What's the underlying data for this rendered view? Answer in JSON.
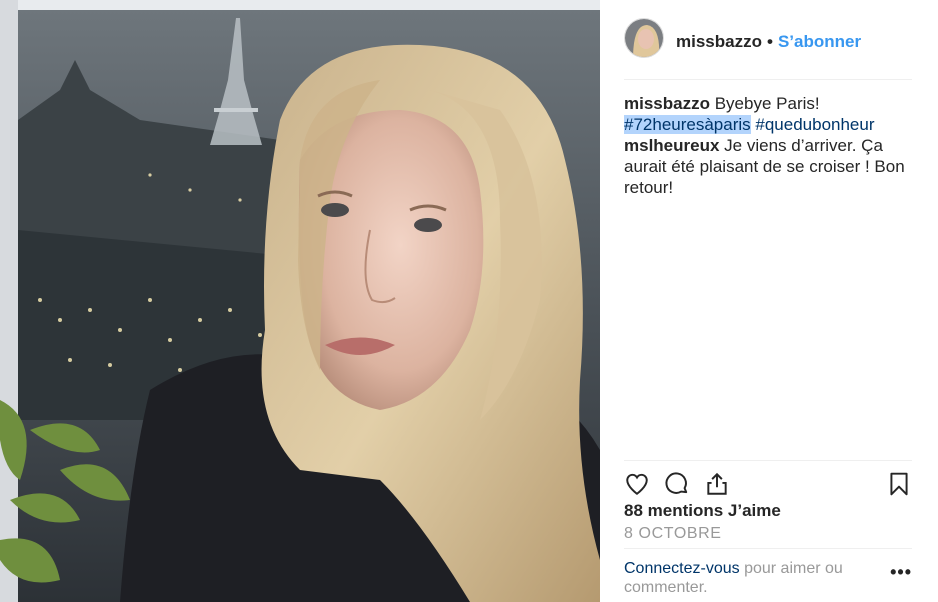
{
  "post": {
    "username": "missbazzo",
    "separator": "•",
    "follow_label": "S’abonner"
  },
  "caption": {
    "user": "missbazzo",
    "text": "Byebye Paris!",
    "hashtags": [
      "#72heuresàparis",
      "#quedubonheur"
    ]
  },
  "comments": [
    {
      "user": "mslheureux",
      "text": "Je viens d’arriver. Ça aurait été plaisant de se croiser ! Bon retour!"
    }
  ],
  "actions": {
    "like_icon": "heart-icon",
    "comment_icon": "comment-icon",
    "share_icon": "share-icon",
    "save_icon": "bookmark-icon"
  },
  "likes_label": "88 mentions J’aime",
  "date_label": "8 OCTOBRE",
  "login": {
    "link": "Connectez-vous",
    "rest": "pour aimer ou commenter.",
    "more": "•••"
  },
  "colors": {
    "link_blue": "#3897f0",
    "hashtag": "#003569",
    "muted": "#999999",
    "border": "#efefef"
  }
}
